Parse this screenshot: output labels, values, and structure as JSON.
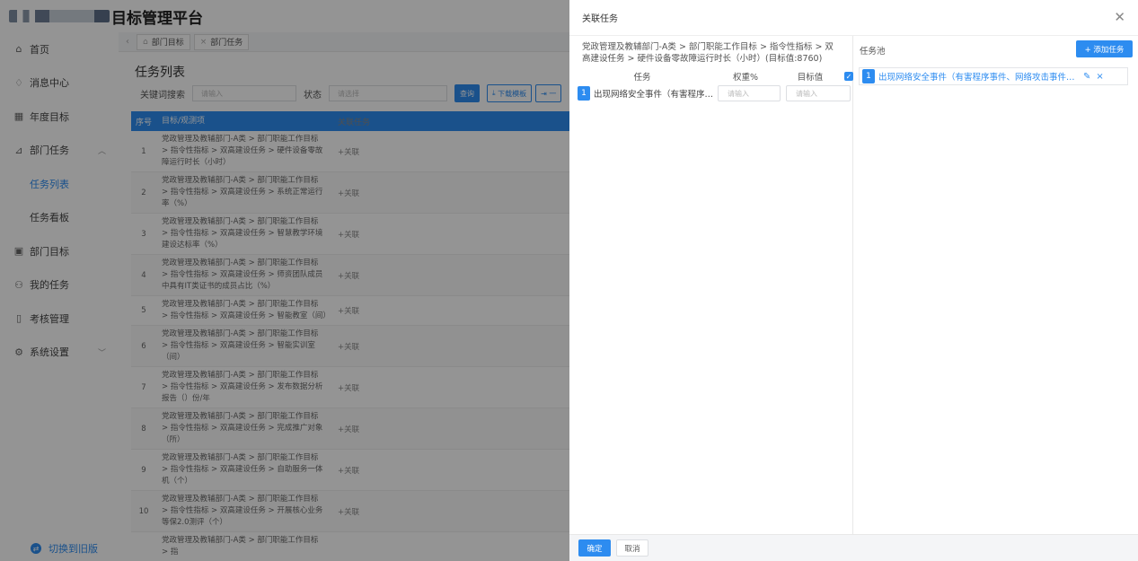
{
  "header": {
    "app_title": "目标管理平台"
  },
  "sidebar": {
    "items": [
      {
        "label": "首页",
        "icon": "home-icon",
        "glyph": "⌂"
      },
      {
        "label": "消息中心",
        "icon": "bell-icon",
        "glyph": "♢"
      },
      {
        "label": "年度目标",
        "icon": "calendar-icon",
        "glyph": "▦"
      },
      {
        "label": "部门任务",
        "icon": "chart-icon",
        "glyph": "⊿",
        "expanded": true
      },
      {
        "label": "任务列表",
        "sub": true,
        "active": true
      },
      {
        "label": "任务看板",
        "sub": true
      },
      {
        "label": "部门目标",
        "icon": "target-icon",
        "glyph": "▣"
      },
      {
        "label": "我的任务",
        "icon": "user-icon",
        "glyph": "⚇"
      },
      {
        "label": "考核管理",
        "icon": "book-icon",
        "glyph": "▯"
      },
      {
        "label": "系统设置",
        "icon": "gear-icon",
        "glyph": "⚙",
        "has_chevron": true
      }
    ],
    "switch_old": "切换到旧版"
  },
  "tabs": [
    {
      "label": "部门目标",
      "icon": "home-icon"
    },
    {
      "label": "部门任务",
      "icon": "close-icon"
    }
  ],
  "main": {
    "title": "任务列表",
    "filters": {
      "keyword_label": "关键词搜索",
      "keyword_placeholder": "请输入",
      "status_label": "状态",
      "status_placeholder": "请选择",
      "query_button": "查询",
      "download_button": "下载模板",
      "import_button": "一"
    },
    "table": {
      "headers": [
        "序号",
        "目标/观测项",
        "关联任务"
      ],
      "rows": [
        {
          "no": "1",
          "goal": "党政管理及教辅部门-A类 > 部门职能工作目标 > 指令性指标 > 双高建设任务 > 硬件设备零故障运行时长（小时）",
          "rel": "+关联"
        },
        {
          "no": "2",
          "goal": "党政管理及教辅部门-A类 > 部门职能工作目标 > 指令性指标 > 双高建设任务 > 系统正常运行率（%）",
          "rel": "+关联"
        },
        {
          "no": "3",
          "goal": "党政管理及教辅部门-A类 > 部门职能工作目标 > 指令性指标 > 双高建设任务 > 智慧教学环境建设达标率（%）",
          "rel": "+关联"
        },
        {
          "no": "4",
          "goal": "党政管理及教辅部门-A类 > 部门职能工作目标 > 指令性指标 > 双高建设任务 > 师资团队成员中具有IT类证书的成员占比（%）",
          "rel": "+关联"
        },
        {
          "no": "5",
          "goal": "党政管理及教辅部门-A类 > 部门职能工作目标 > 指令性指标 > 双高建设任务 > 智能教室（间）",
          "rel": "+关联"
        },
        {
          "no": "6",
          "goal": "党政管理及教辅部门-A类 > 部门职能工作目标 > 指令性指标 > 双高建设任务 > 智能实训室（间）",
          "rel": "+关联"
        },
        {
          "no": "7",
          "goal": "党政管理及教辅部门-A类 > 部门职能工作目标 > 指令性指标 > 双高建设任务 > 发布数据分析报告（）份/年",
          "rel": "+关联"
        },
        {
          "no": "8",
          "goal": "党政管理及教辅部门-A类 > 部门职能工作目标 > 指令性指标 > 双高建设任务 > 完成推广对象（所）",
          "rel": "+关联"
        },
        {
          "no": "9",
          "goal": "党政管理及教辅部门-A类 > 部门职能工作目标 > 指令性指标 > 双高建设任务 > 自助服务一体机（个）",
          "rel": "+关联"
        },
        {
          "no": "10",
          "goal": "党政管理及教辅部门-A类 > 部门职能工作目标 > 指令性指标 > 双高建设任务 > 开展核心业务等保2.0测评（个）",
          "rel": "+关联"
        },
        {
          "no": "",
          "goal": "党政管理及教辅部门-A类 > 部门职能工作目标 > 指",
          "rel": ""
        }
      ]
    }
  },
  "drawer": {
    "title": "关联任务",
    "path": "党政管理及教辅部门-A类 > 部门职能工作目标 > 指令性指标 > 双高建设任务 > 硬件设备零故障运行时长（小时）(目标值:8760)",
    "columns": {
      "task": "任务",
      "weight": "权重%",
      "target": "目标值"
    },
    "task_row": {
      "index": "1",
      "name": "出现网络安全事件（有害程序事件、网络攻击事件、",
      "weight_placeholder": "请输入",
      "target_placeholder": "请输入"
    },
    "pool": {
      "title": "任务池",
      "add_button": "+ 添加任务",
      "items": [
        {
          "index": "1",
          "name": "出现网络安全事件（有害程序事件、网络攻击事件、信息破坏事件）",
          "checked": true
        }
      ]
    },
    "footer": {
      "ok": "确定",
      "cancel": "取消"
    }
  },
  "colors": {
    "primary": "#2d8cf0",
    "mask": "rgba(0,0,0,0.42)"
  }
}
